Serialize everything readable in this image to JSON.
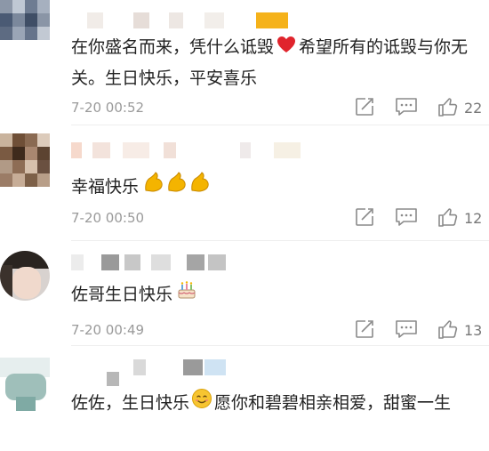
{
  "comments": [
    {
      "text_a": "在你盛名而来，凭什么诋毁",
      "text_b": "希望所有的诋毁与你无关。生日快乐，平安喜乐",
      "emoji_a": "red-heart-icon",
      "time": "7-20 00:52",
      "likes": "22"
    },
    {
      "text_a": "幸福快乐",
      "emoji_a": "flexed-biceps-icon",
      "time": "7-20 00:50",
      "likes": "12"
    },
    {
      "text_a": "佐哥生日快乐",
      "emoji_a": "birthday-cake-icon",
      "time": "7-20 00:49",
      "likes": "13"
    },
    {
      "text_a": "佐佐，生日快乐",
      "text_b": "愿你和碧碧相亲相爱，甜蜜一生",
      "emoji_a": "smiling-face-icon"
    }
  ],
  "colors": {
    "accent": "#f7b500",
    "timestamp": "#9a9a9a",
    "heart": "#e0242c"
  }
}
